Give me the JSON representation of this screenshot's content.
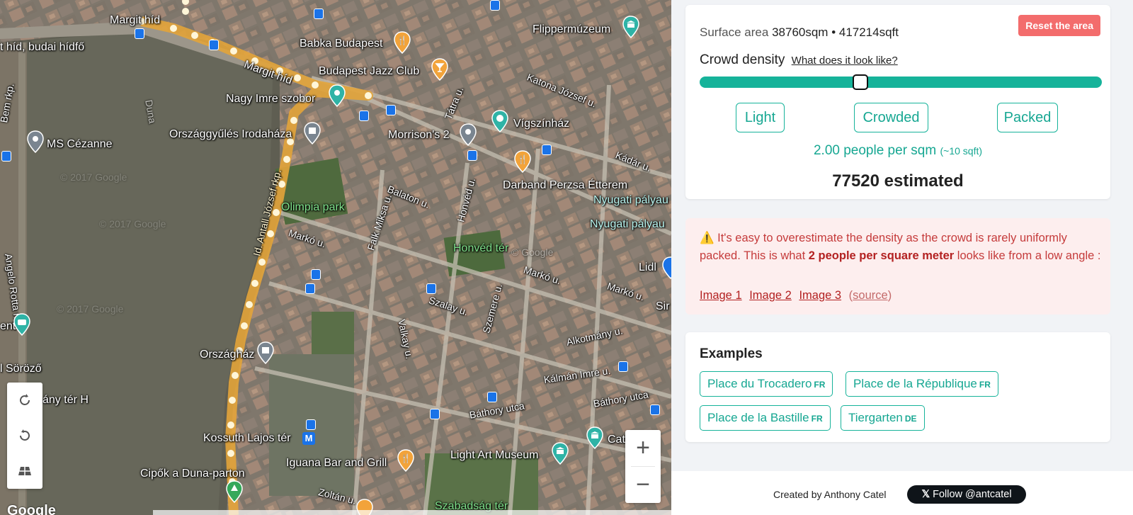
{
  "map": {
    "labels": {
      "margit_hid_top": "Margit híd",
      "margit_hid_road": "Margit híd",
      "hid_budai": "t híd, budai hídfő",
      "babka": "Babka Budapest",
      "flippermuzeum": "Flippermúzeum",
      "jazz_club": "Budapest Jazz Club",
      "nagy_imre": "Nagy Imre szobor",
      "katona": "Katona József u.",
      "tatra": "Tátra u.",
      "vigszinhaz": "Vígszínház",
      "morrison": "Morrison's 2",
      "orszaggyules_iroda": "Országgyűlés Irodaháza",
      "ms_cezanne": "MS Cézanne",
      "duna": "Duna",
      "bem_rkp": "Bem rkp.",
      "balaton": "Balaton u.",
      "darband": "Darband Perzsa Étterem",
      "nyugati1": "Nyugati pályau",
      "nyugati2": "Nyugati pályau",
      "kadar": "Kádár u.",
      "olimpia": "Olimpia park",
      "honved_u": "Honvéd u.",
      "falk": "Falk Miksa u.",
      "marko1": "Markó u.",
      "marko2": "Markó u.",
      "marko3": "Markó u.",
      "honved_ter": "Honvéd tér",
      "angelo": "Angelo Rotta rkp.",
      "szalay": "Szalay u.",
      "szemere": "Szemere u.",
      "valkay": "Valkay u.",
      "alkotmany": "Alkotmány u.",
      "orszaghaz": "Országház",
      "lidl": "Lidl",
      "sir": "Sir",
      "kalman": "Kálmán Imre u.",
      "bathory1": "Báthory utca",
      "bathory2": "Báthory utca",
      "sorozo": "l Söröző",
      "any_ter": "ány tér H",
      "ent": "ent",
      "kossuth": "Kossuth Lajos tér",
      "iguana": "Iguana Bar and Grill",
      "light_art": "Light Art Museum",
      "cipok": "Cipők a Duna-parton",
      "zoltan": "Zoltán u.",
      "szabadsag": "Szabadság tér",
      "cat": "Cat",
      "copyright1": "© 2017 Google",
      "copyright2": "© 2017 Google",
      "copyright3": "© 2017 Google",
      "copyright4": "© Google",
      "jozsef_rkp": "Id. Antall József rkp."
    },
    "google_logo": "Google",
    "zoom_in": "+",
    "zoom_out": "−"
  },
  "area": {
    "surface_label": "Surface area",
    "surface_value": "38760sqm • 417214sqft",
    "reset_label": "Reset the area"
  },
  "density": {
    "title": "Crowd density",
    "link": "What does it look like?",
    "slider_fraction": 0.4,
    "presets": {
      "light": "Light",
      "crowded": "Crowded",
      "packed": "Packed"
    },
    "per_sqm": "2.00 people per sqm",
    "per_sqft": "(~10 sqft)",
    "estimated": "77520 estimated"
  },
  "warning": {
    "icon": "⚠️",
    "text_before": "It's easy to overestimate the density as the crowd is rarely uniformly packed. This is what ",
    "bold": "2 people per square meter",
    "text_after": " looks like from a low angle :",
    "links": [
      "Image 1",
      "Image 2",
      "Image 3"
    ],
    "source": "source"
  },
  "examples": {
    "title": "Examples",
    "items": [
      {
        "name": "Place du Trocadero",
        "country": "FR"
      },
      {
        "name": "Place de la République",
        "country": "FR"
      },
      {
        "name": "Place de la Bastille",
        "country": "FR"
      },
      {
        "name": "Tiergarten",
        "country": "DE"
      }
    ]
  },
  "footer": {
    "credit": "Created by Anthony Catel",
    "follow_icon": "𝕏",
    "follow": "Follow @antcatel"
  },
  "colors": {
    "accent": "#16b39a",
    "reset": "#f36c6c",
    "warning_bg": "#fdeeee",
    "warning_text": "#c53b3b",
    "route": "#e3a43a"
  }
}
